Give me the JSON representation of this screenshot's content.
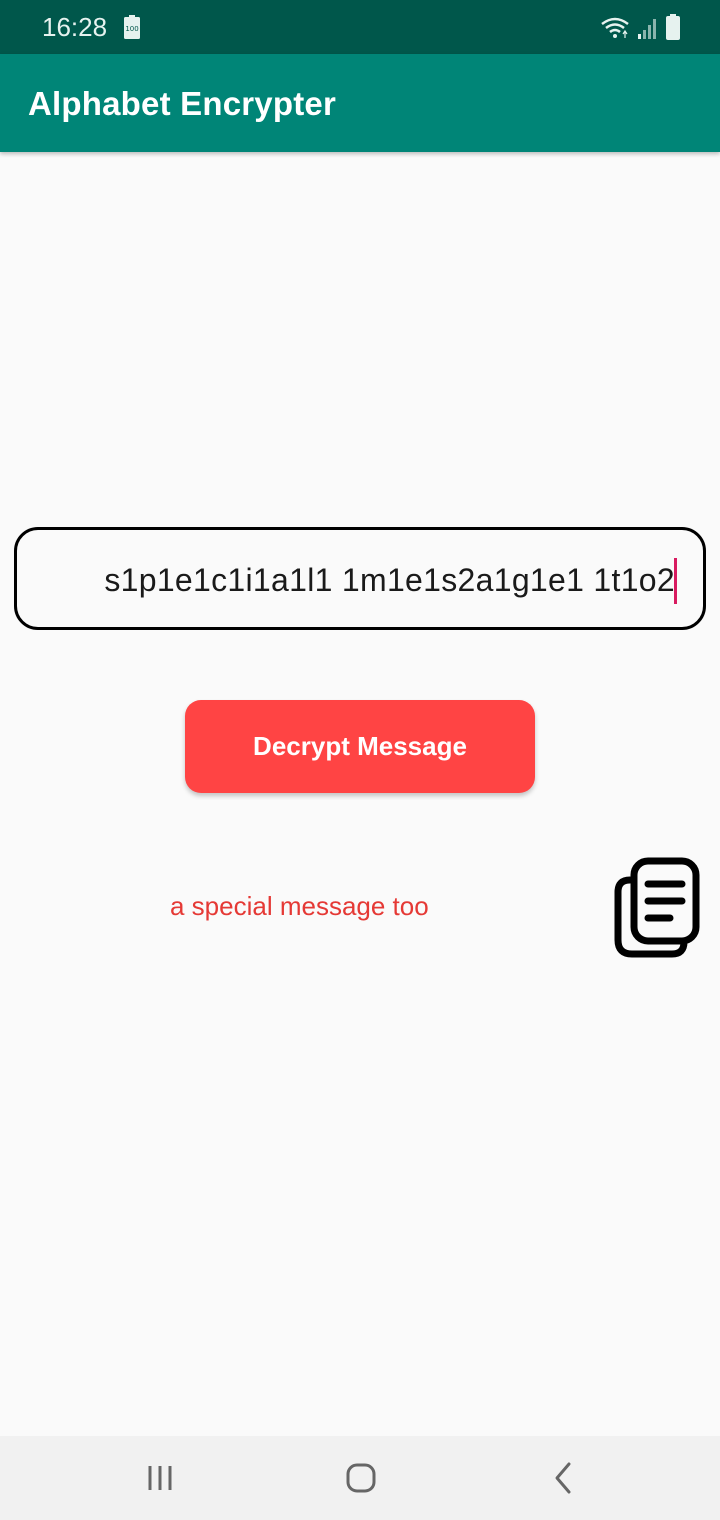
{
  "status": {
    "time": "16:28",
    "battery_label": "100"
  },
  "app_bar": {
    "title": "Alphabet Encrypter"
  },
  "input": {
    "value": "s1p1e1c1i1a1l1 1m1e1s2a1g1e1 1t1o2"
  },
  "decrypt_button": {
    "label": "Decrypt Message"
  },
  "result": {
    "text": "a special message too"
  },
  "colors": {
    "status_bar": "#00574b",
    "app_bar": "#008577",
    "button": "#ff4444",
    "result_text": "#e53935",
    "caret": "#d81b60"
  },
  "icons": {
    "copy": "copy-icon",
    "recents": "recents-icon",
    "home": "home-icon",
    "back": "back-icon"
  }
}
